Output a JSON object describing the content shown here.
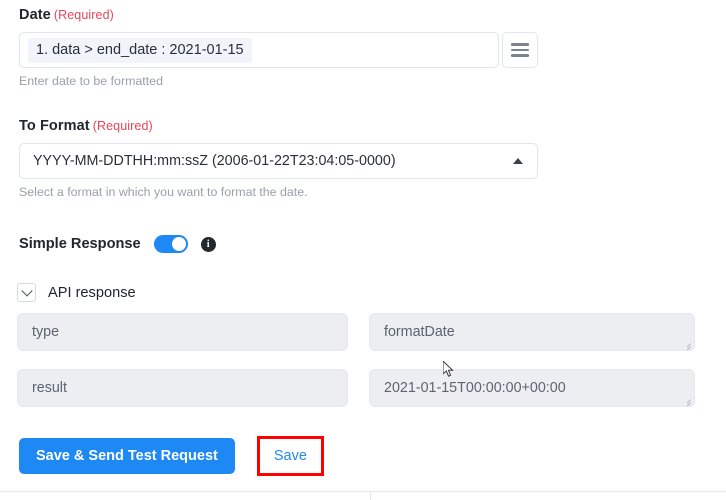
{
  "date_field": {
    "label": "Date",
    "required_tag": "(Required)",
    "token_value": "1. data > end_date : 2021-01-15",
    "helper": "Enter date to be formatted",
    "menu_icon": "hamburger-icon"
  },
  "format_field": {
    "label": "To Format",
    "required_tag": "(Required)",
    "selected_value": "YYYY-MM-DDTHH:mm:ssZ (2006-01-22T23:04:05-0000)",
    "helper": "Select a format in which you want to format the date.",
    "caret_icon": "caret-up-icon"
  },
  "simple_response": {
    "label": "Simple Response",
    "enabled": true,
    "info_glyph": "i",
    "info_icon": "info-icon",
    "accent": "#1e88f5"
  },
  "api_response": {
    "title": "API response",
    "expanded": true,
    "chevron_icon": "chevron-down-icon",
    "rows": [
      {
        "key": "type",
        "value": "formatDate"
      },
      {
        "key": "result",
        "value": "2021-01-15T00:00:00+00:00"
      }
    ]
  },
  "actions": {
    "primary_label": "Save & Send Test Request",
    "save_label": "Save",
    "primary_color": "#1e88f5",
    "highlight_color": "#ff0000"
  }
}
